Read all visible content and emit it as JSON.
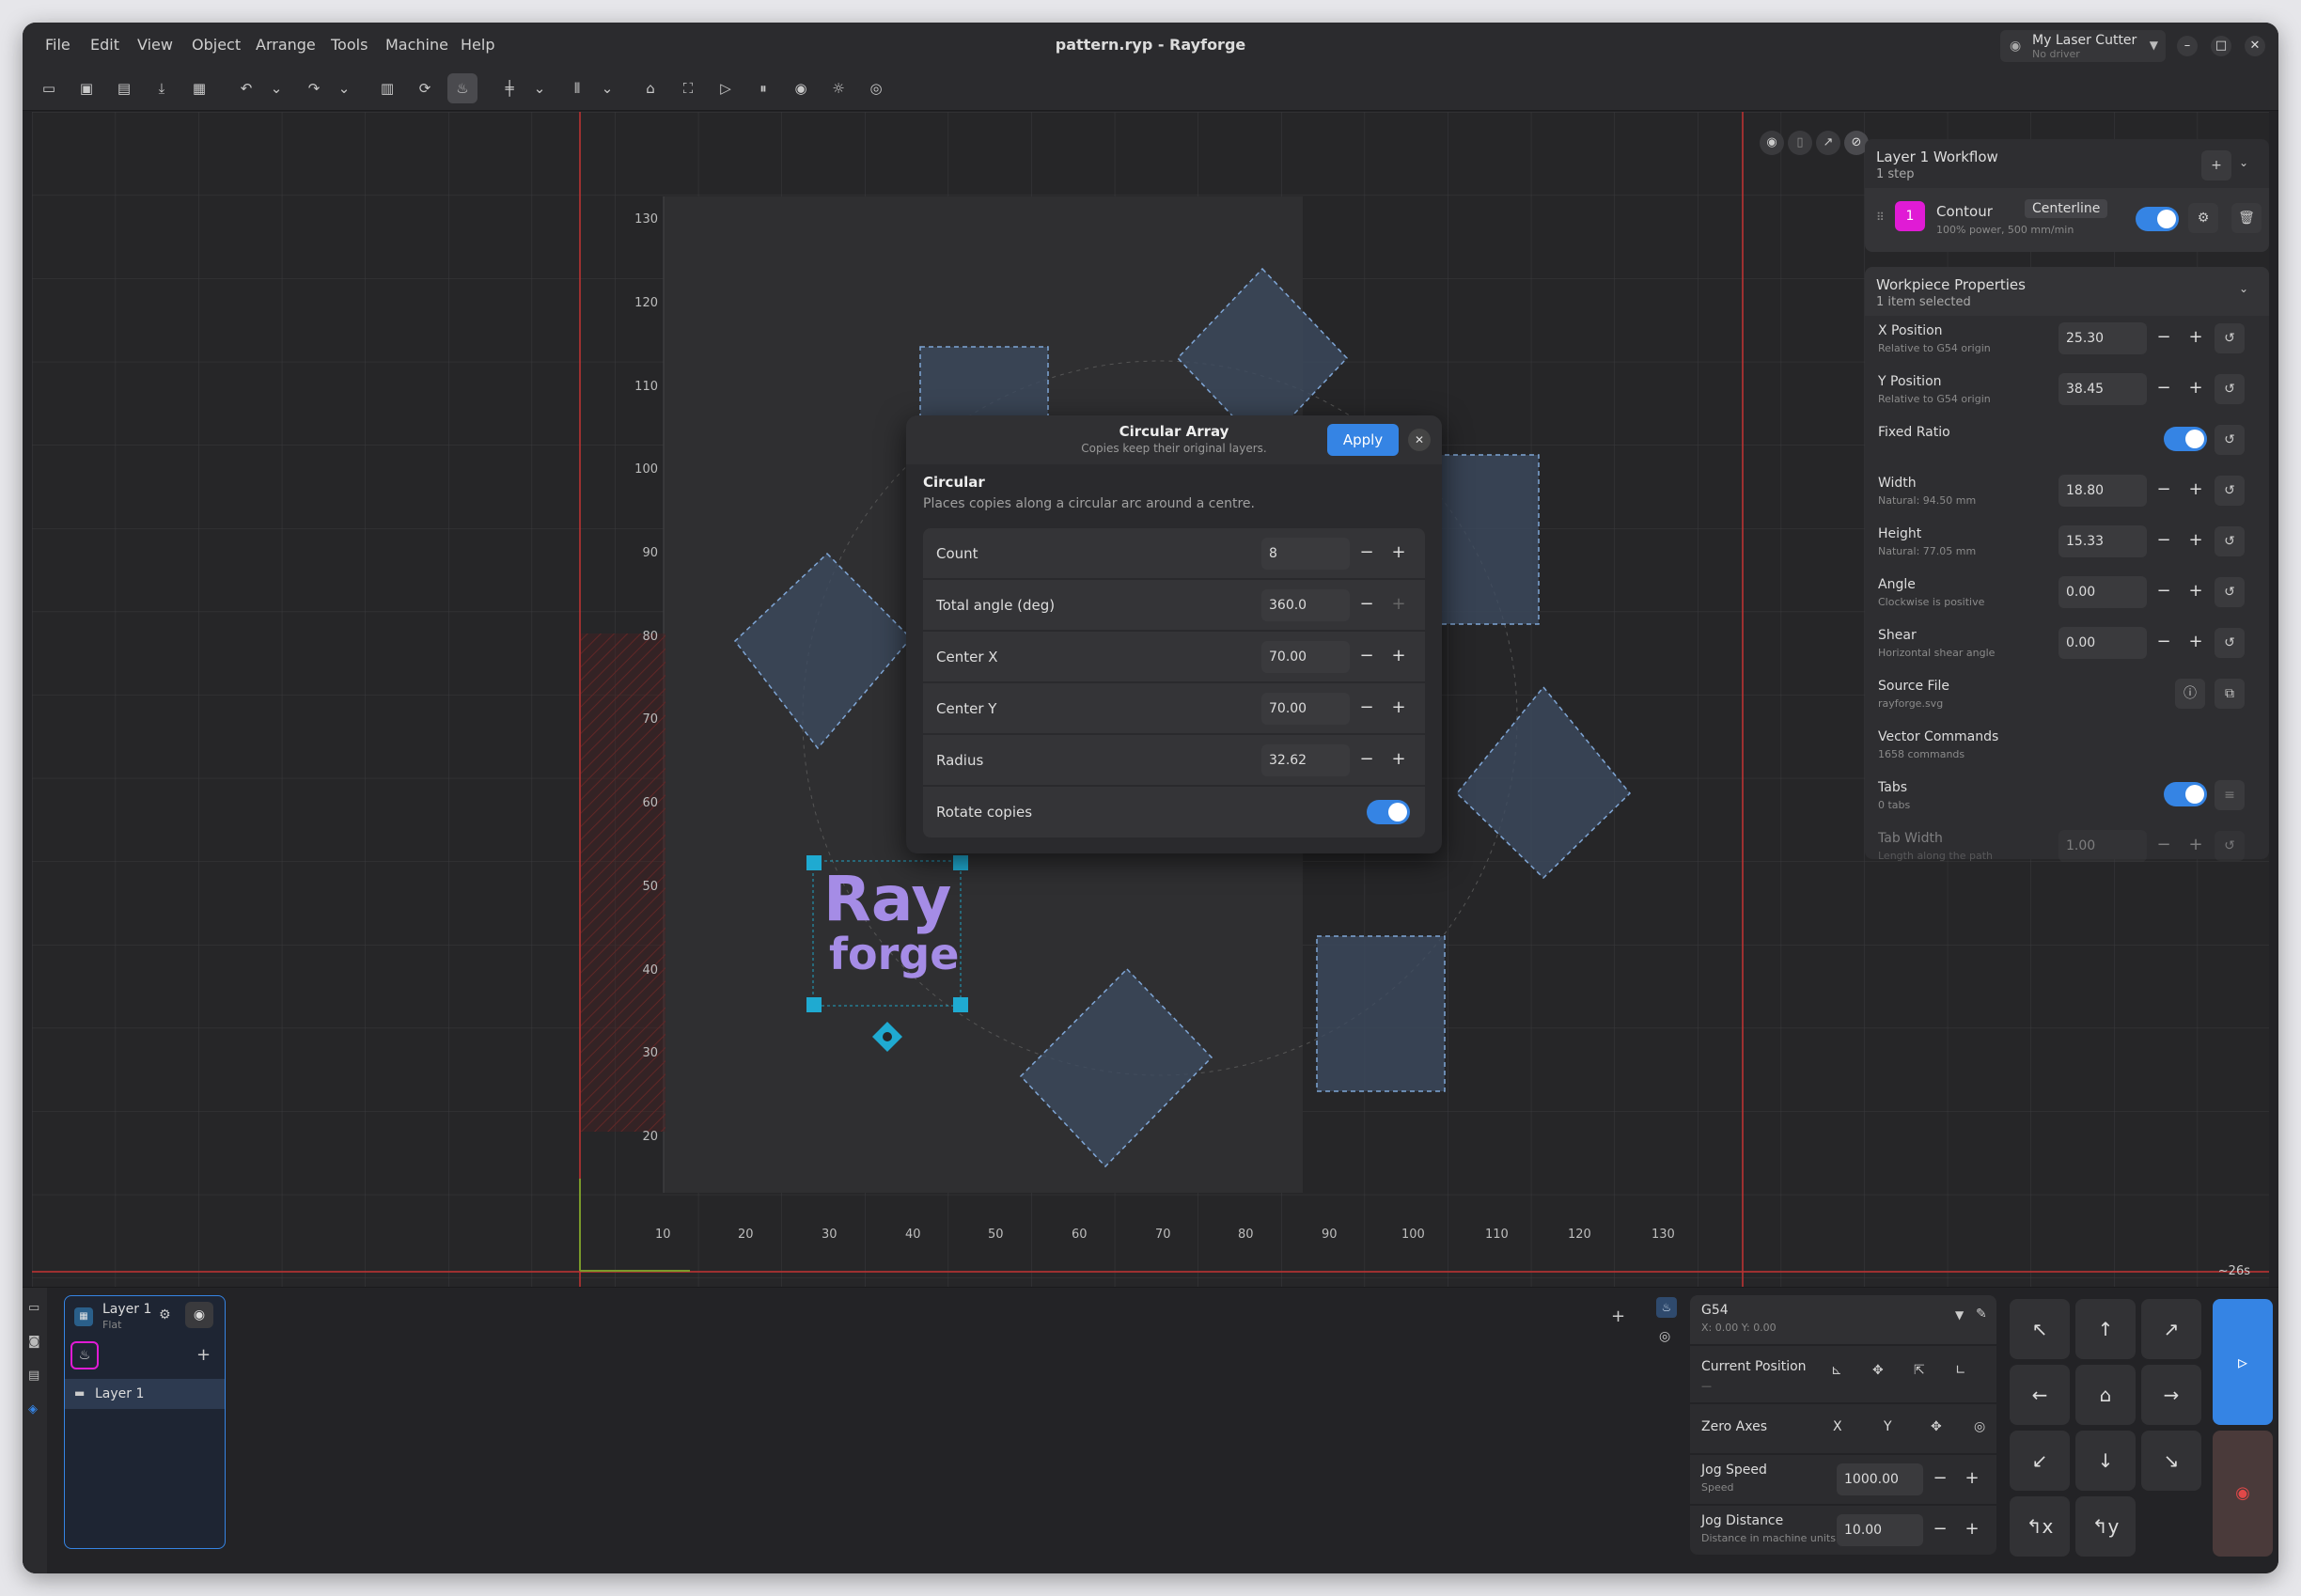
{
  "window": {
    "title": "pattern.ryp - Rayforge",
    "menus": [
      "File",
      "Edit",
      "View",
      "Object",
      "Arrange",
      "Tools",
      "Machine",
      "Help"
    ],
    "machine_name": "My Laser Cutter",
    "machine_driver": "No driver"
  },
  "toolbar": {
    "icons": [
      "open-icon",
      "save-icon",
      "save-as-icon",
      "export-icon",
      "export-gcode-icon",
      "undo-icon",
      "undo-dropdown-icon",
      "redo-icon",
      "redo-dropdown-icon",
      "group-icon",
      "refresh-icon",
      "laser-icon",
      "align-icon",
      "align-dropdown-icon",
      "distribute-icon",
      "distribute-dropdown-icon",
      "home-icon",
      "frame-icon",
      "play-icon",
      "pause-icon",
      "record-icon",
      "brightness-icon",
      "target-icon"
    ]
  },
  "canvas": {
    "x_ticks": [
      "10",
      "20",
      "30",
      "40",
      "50",
      "60",
      "70",
      "80",
      "90",
      "100",
      "110",
      "120",
      "130"
    ],
    "y_ticks": [
      "130",
      "120",
      "110",
      "100",
      "90",
      "80",
      "70",
      "60",
      "50",
      "40",
      "30",
      "20"
    ],
    "logo_line1": "Ray",
    "logo_line2": "forge",
    "timer": "~26s"
  },
  "workflow": {
    "title": "Layer 1 Workflow",
    "steps": "1 step",
    "step_num": "1",
    "step_name": "Contour",
    "step_tag": "Centerline",
    "step_desc": "100% power, 500 mm/min"
  },
  "workpiece": {
    "title": "Workpiece Properties",
    "subtitle": "1 item selected",
    "x_label": "X Position",
    "x_sub": "Relative to G54 origin",
    "x_val": "25.30",
    "y_label": "Y Position",
    "y_sub": "Relative to G54 origin",
    "y_val": "38.45",
    "ratio_label": "Fixed Ratio",
    "w_label": "Width",
    "w_sub": "Natural: 94.50 mm",
    "w_val": "18.80",
    "h_label": "Height",
    "h_sub": "Natural: 77.05 mm",
    "h_val": "15.33",
    "a_label": "Angle",
    "a_sub": "Clockwise is positive",
    "a_val": "0.00",
    "s_label": "Shear",
    "s_sub": "Horizontal shear angle",
    "s_val": "0.00",
    "src_label": "Source File",
    "src_sub": "rayforge.svg",
    "vec_label": "Vector Commands",
    "vec_sub": "1658 commands",
    "tabs_label": "Tabs",
    "tabs_sub": "0 tabs",
    "tw_label": "Tab Width",
    "tw_sub": "Length along the path",
    "tw_val": "1.00"
  },
  "dialog": {
    "title": "Circular Array",
    "subtitle": "Copies keep their original layers.",
    "apply": "Apply",
    "section": "Circular",
    "section_desc": "Places copies along a circular arc around a centre.",
    "count_label": "Count",
    "count": "8",
    "angle_label": "Total angle (deg)",
    "angle": "360.0",
    "cx_label": "Center X",
    "cx": "70.00",
    "cy_label": "Center Y",
    "cy": "70.00",
    "r_label": "Radius",
    "r": "32.62",
    "rot_label": "Rotate copies"
  },
  "layers": {
    "layer_name": "Layer 1",
    "layer_type": "Flat",
    "item": "Layer 1"
  },
  "control": {
    "wcs": "G54",
    "coords": "X: 0.00  Y: 0.00",
    "cur_pos": "Current Position",
    "cur_sub": "—",
    "zero": "Zero Axes",
    "zx": "X",
    "zy": "Y",
    "speed_label": "Jog Speed",
    "speed_sub": "Speed",
    "speed": "1000.00",
    "dist_label": "Jog Distance",
    "dist_sub": "Distance in machine units",
    "dist": "10.00"
  },
  "colors": {
    "accent": "#3584e4",
    "step": "#e01bd5",
    "outline": "#c01c28"
  }
}
